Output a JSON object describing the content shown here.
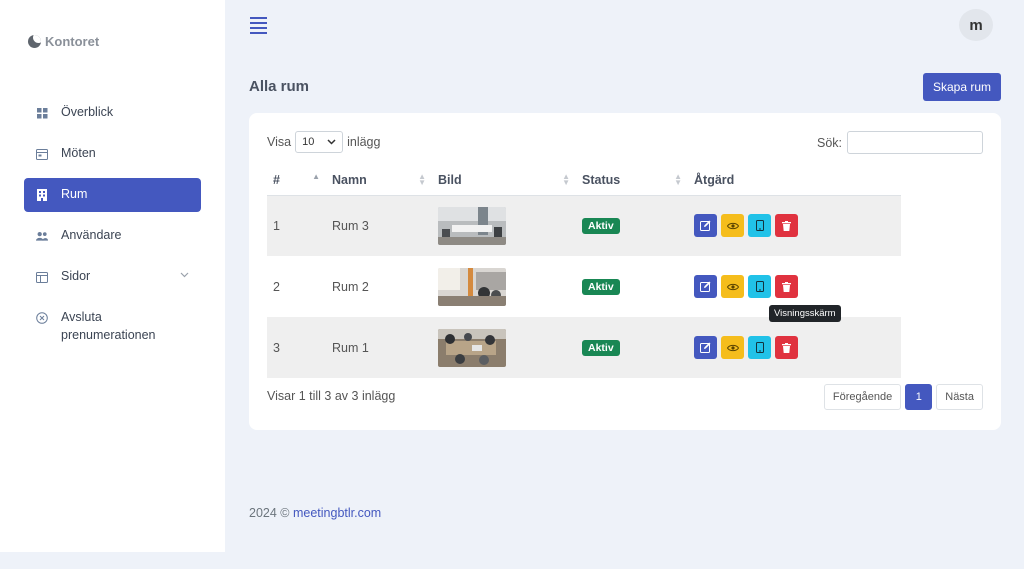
{
  "brand": {
    "name": "Kontoret"
  },
  "sidebar": {
    "items": [
      {
        "label": "Överblick",
        "icon": "grid-icon"
      },
      {
        "label": "Möten",
        "icon": "calendar-icon"
      },
      {
        "label": "Rum",
        "icon": "building-icon",
        "active": true
      },
      {
        "label": "Användare",
        "icon": "users-icon"
      },
      {
        "label": "Sidor",
        "icon": "layout-icon"
      },
      {
        "label": "Avsluta prenumerationen",
        "icon": "close-circle-icon"
      }
    ]
  },
  "header": {
    "avatar_initial": "m"
  },
  "main": {
    "title": "Alla rum",
    "create_label": "Skapa rum",
    "show_prefix": "Visa",
    "show_value": "10",
    "show_suffix": "inlägg",
    "search_label": "Sök:",
    "columns": [
      "#",
      "Namn",
      "Bild",
      "Status",
      "Åtgärd"
    ],
    "rows": [
      {
        "num": "1",
        "name": "Rum 3",
        "status": "Aktiv"
      },
      {
        "num": "2",
        "name": "Rum 2",
        "status": "Aktiv"
      },
      {
        "num": "3",
        "name": "Rum 1",
        "status": "Aktiv"
      }
    ],
    "tooltip": "Visningsskärm",
    "info": "Visar 1 till 3 av 3 inlägg",
    "pagination": {
      "prev": "Föregående",
      "page": "1",
      "next": "Nästa"
    }
  },
  "footer": {
    "year": "2024 ©",
    "link": "meetingbtlr.com"
  },
  "colors": {
    "primary": "#4458bf",
    "success": "#198754",
    "warning": "#f5bd1c",
    "info": "#21c2e8",
    "danger": "#e0323f"
  }
}
